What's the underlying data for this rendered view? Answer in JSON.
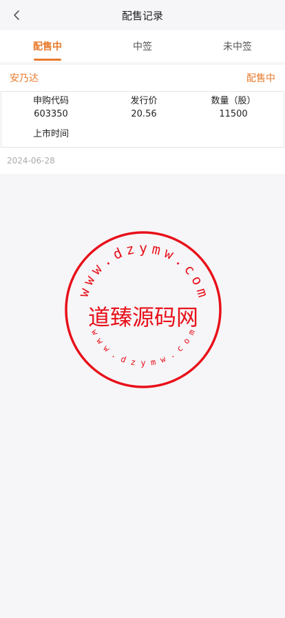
{
  "header": {
    "title": "配售记录",
    "back_icon": "chevron-left-icon"
  },
  "tabs": [
    {
      "label": "配售中",
      "active": true
    },
    {
      "label": "中签",
      "active": false
    },
    {
      "label": "未中签",
      "active": false
    }
  ],
  "record": {
    "name": "安乃达",
    "status": "配售中",
    "code_label": "申购代码",
    "code_value": "603350",
    "price_label": "发行价",
    "price_value": "20.56",
    "qty_label": "数量（股）",
    "qty_value": "11500",
    "listing_label": "上市时间",
    "date": "2024-06-28"
  },
  "watermark": {
    "center_text": "道臻源码网",
    "top_chars": [
      "w",
      "w",
      "w",
      ".",
      "d",
      "z",
      "y",
      "m",
      "w",
      ".",
      "c",
      "o",
      "m"
    ],
    "bottom_chars": [
      "w",
      "w",
      "w",
      ".",
      "d",
      "z",
      "y",
      "m",
      "w",
      ".",
      "c",
      "o",
      "m"
    ],
    "color": "#e8101a"
  },
  "colors": {
    "accent": "#e87a2c",
    "background": "#f6f6f8"
  }
}
